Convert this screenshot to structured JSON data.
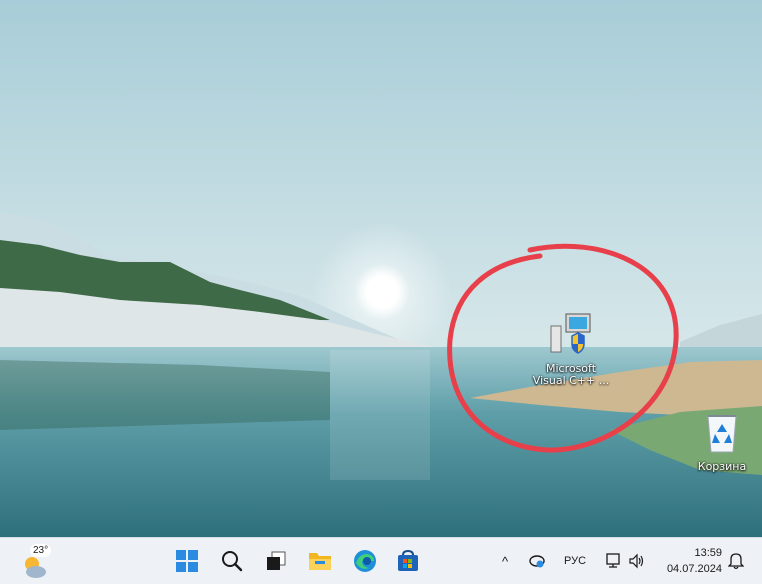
{
  "desktop": {
    "icons": [
      {
        "label_line1": "Microsoft",
        "label_line2": "Visual C++ ...",
        "icon": "installer-shield-icon"
      },
      {
        "label": "Корзина",
        "icon": "recycle-bin-icon"
      }
    ],
    "annotation_color": "#e8404a"
  },
  "taskbar": {
    "weather": {
      "temp": "23°",
      "icon": "weather-sun-cloud-icon"
    },
    "apps": [
      "start-icon",
      "search-icon",
      "task-view-icon",
      "file-explorer-icon",
      "edge-icon",
      "store-icon"
    ],
    "tray": {
      "overflow": "^",
      "language": "РУС"
    },
    "clock": {
      "time": "13:59",
      "date": "04.07.2024"
    }
  }
}
